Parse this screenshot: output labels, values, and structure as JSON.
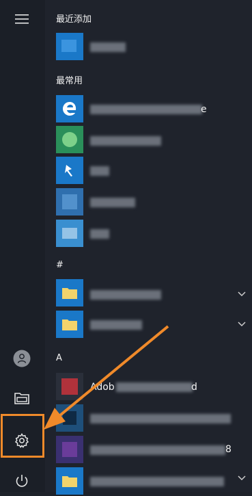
{
  "start_menu": {
    "sections": {
      "recent": "最近添加",
      "most_used": "最常用",
      "hash": "#",
      "a": "A"
    },
    "visible_label_fragments": {
      "edge_suffix": "e",
      "adobe_prefix": "Adob",
      "adobe_suffix": "d",
      "row_8_suffix": "8"
    }
  },
  "icons": {
    "menu": "hamburger-icon",
    "user": "user-avatar-icon",
    "documents": "folder-icon",
    "settings": "gear-icon",
    "power": "power-icon"
  },
  "colors": {
    "accent": "#1a78c8",
    "highlight": "#f08a2a",
    "background": "#1f232c",
    "rail": "#1b1f27"
  }
}
